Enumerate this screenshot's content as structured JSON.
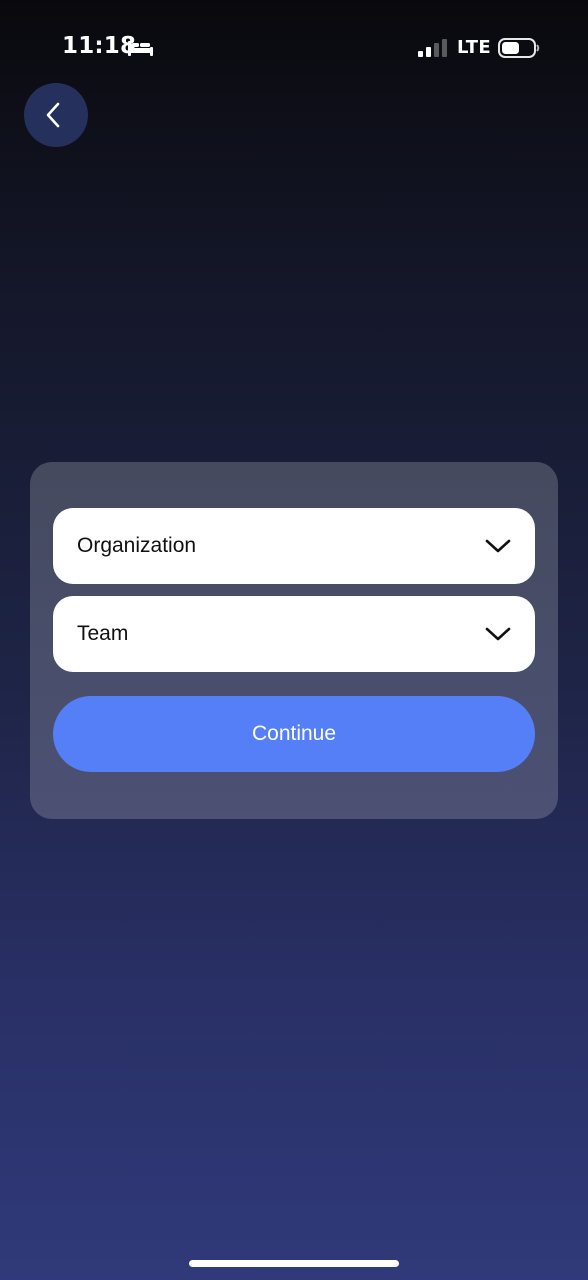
{
  "status_bar": {
    "time": "11:18",
    "network": "LTE",
    "icons": {
      "sleep": "bed-icon",
      "signal": "cellular-signal-icon",
      "battery": "battery-icon"
    }
  },
  "navigation": {
    "back_icon": "chevron-left-icon"
  },
  "form": {
    "organization": {
      "value": "Organization",
      "icon": "chevron-down-icon"
    },
    "team": {
      "value": "Team",
      "icon": "chevron-down-icon"
    },
    "continue_label": "Continue"
  },
  "colors": {
    "accent": "#557ff7",
    "background_top": "#09090d",
    "background_bottom": "#303a7a",
    "card": "#4a4f6a",
    "back_button": "#26305c"
  }
}
